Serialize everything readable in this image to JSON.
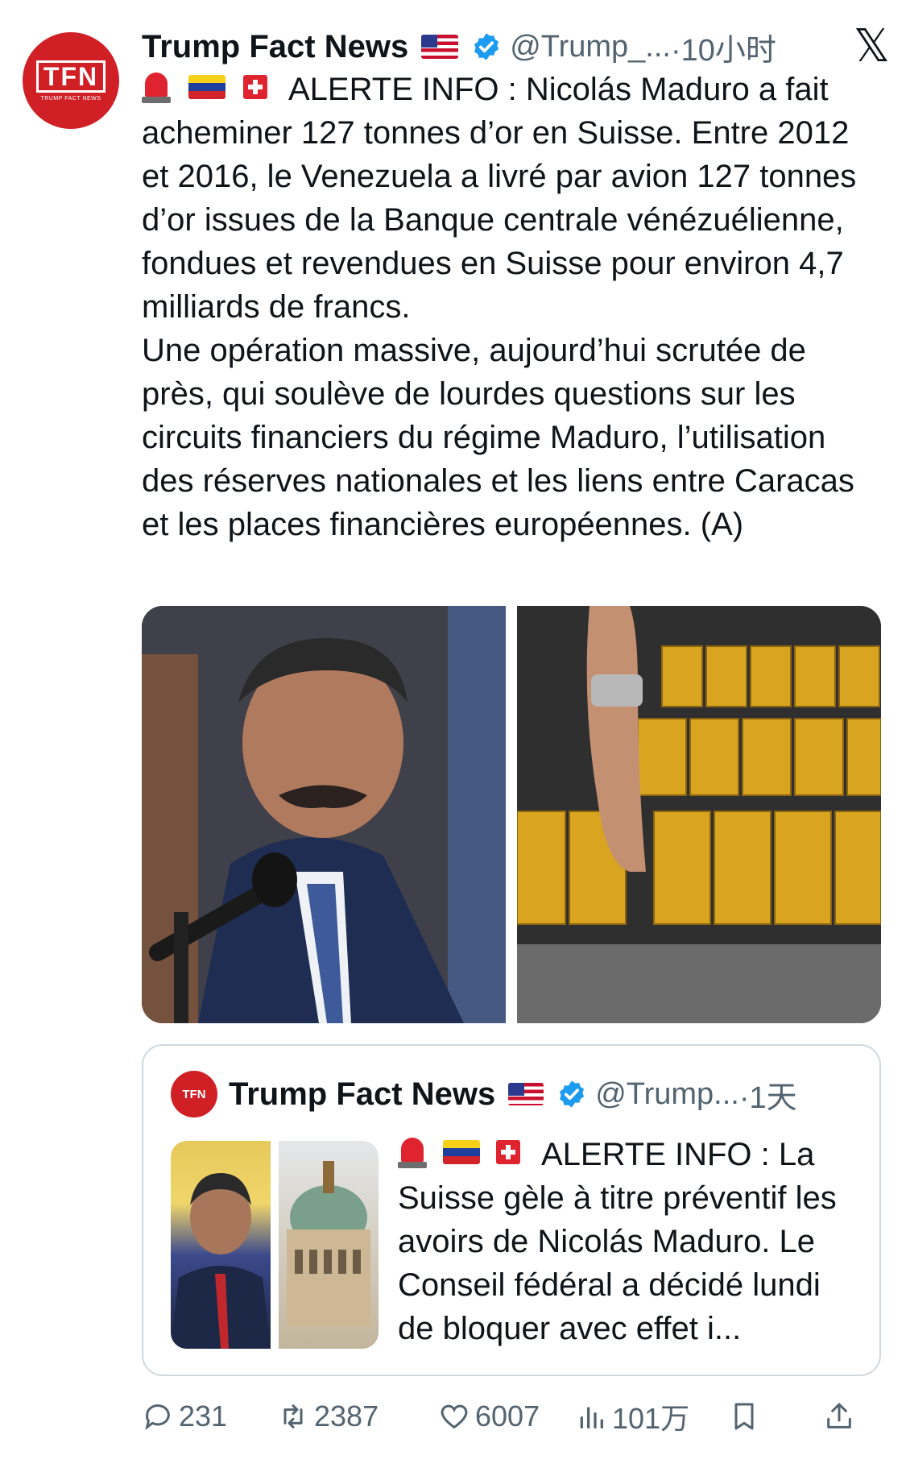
{
  "tweet": {
    "avatar_logo": "TFN",
    "avatar_sub": "TRUMP FACT NEWS",
    "author_name": "Trump Fact News",
    "handle": "@Trump_...",
    "time": "·10小时",
    "platform_logo": "𝕏",
    "lead": "ALERTE INFO : Nicolás Maduro a fait acheminer 127 tonnes d’or en Suisse. Entre 2012 et 2016, le Venezuela a livré par avion 127 tonnes d’or issues de la Banque centrale vénézuélienne, fondues et revendues en Suisse pour environ 4,7 milliards de francs.",
    "body": "Une opération massive, aujourd’hui scrutée de près, qui soulève de lourdes questions sur les circuits financiers du régime Maduro, l’utilisation des réserves nationales et les liens entre Caracas et les places financières européennes. (A)",
    "emoji_icons": [
      "siren-emoji",
      "venezuela-flag",
      "switzerland-flag"
    ]
  },
  "quoted": {
    "avatar_logo": "TFN",
    "author_name": "Trump Fact News",
    "handle": "@Trump...",
    "time": "·1天",
    "text": "ALERTE INFO : La Suisse gèle à titre préventif les avoirs de Nicolás Maduro. Le Conseil fédéral a décidé lundi de bloquer avec effet i..."
  },
  "actions": {
    "replies": "231",
    "retweets": "2387",
    "likes": "6007",
    "views": "101万"
  },
  "colors": {
    "brand_red": "#d11f26",
    "verified_blue": "#1d9bf0",
    "secondary_text": "#536471"
  }
}
